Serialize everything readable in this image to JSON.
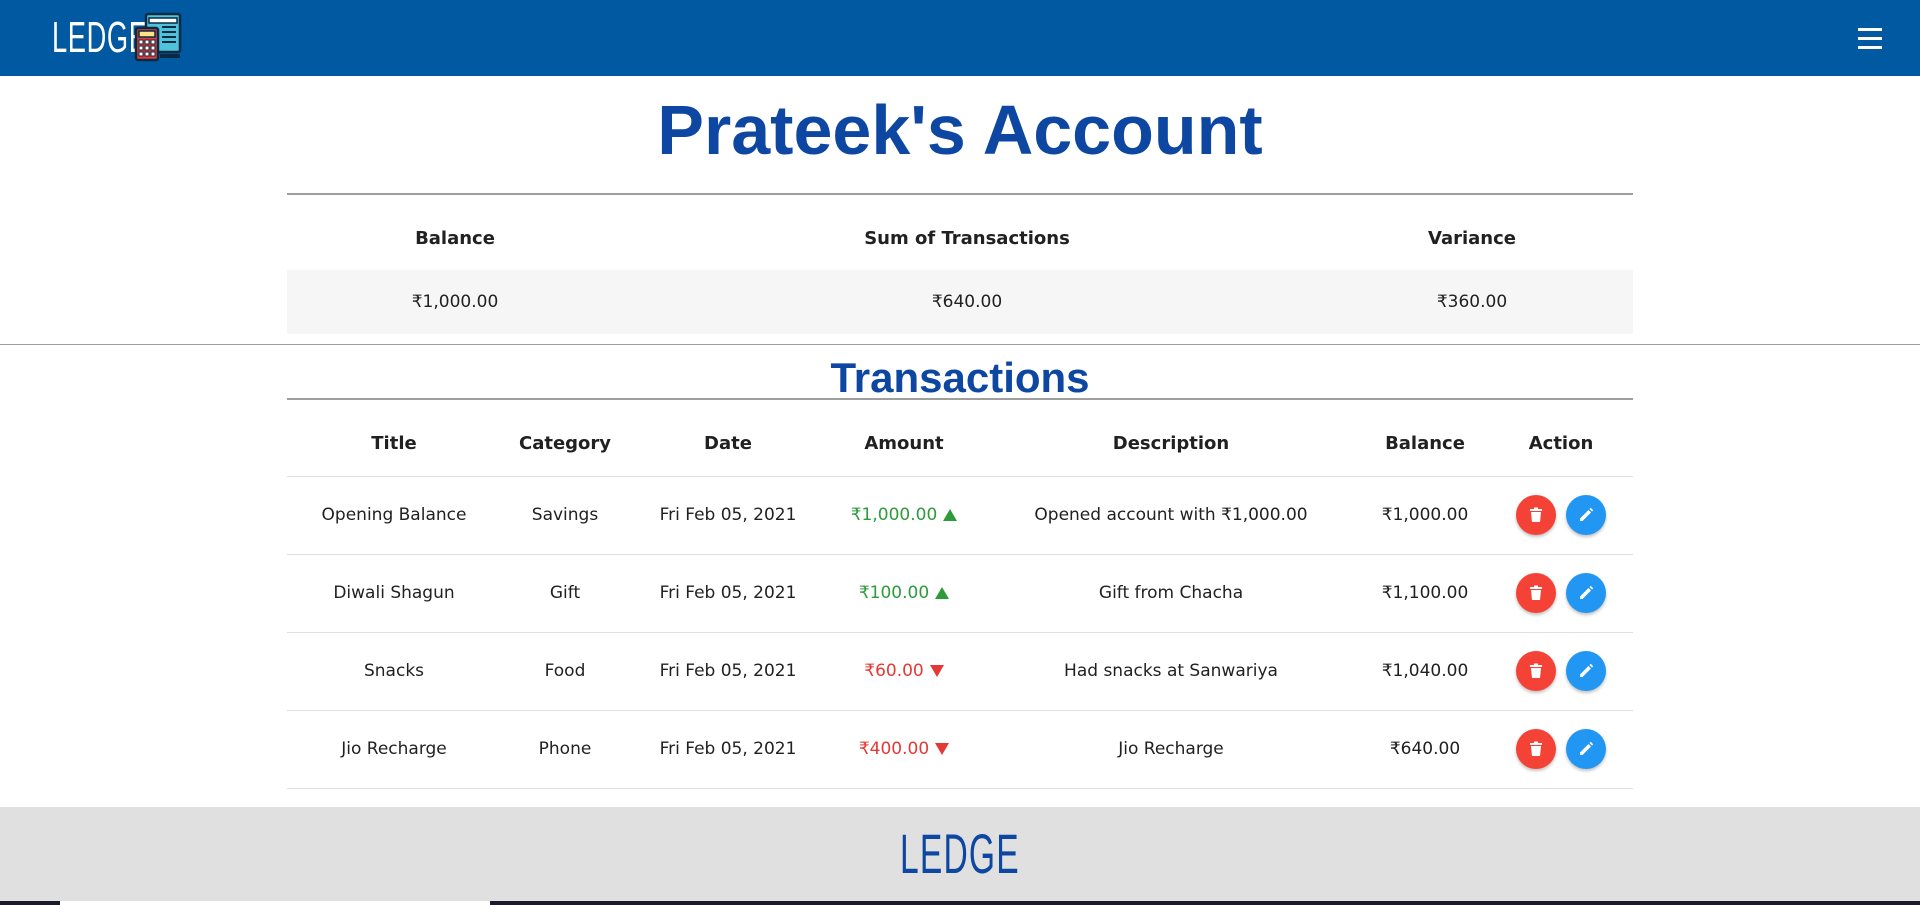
{
  "navbar": {
    "brand": "LEDGE",
    "logo_icon": "calculator-ledger-icon",
    "menu_icon": "hamburger-menu-icon",
    "background": "#0059a1"
  },
  "page": {
    "title": "Prateek's Account"
  },
  "summary": {
    "headers": [
      "Balance",
      "Sum of Transactions",
      "Variance"
    ],
    "values": [
      "₹1,000.00",
      "₹640.00",
      "₹360.00"
    ]
  },
  "transactions": {
    "title": "Transactions",
    "headers": [
      "Title",
      "Category",
      "Date",
      "Amount",
      "Description",
      "Balance",
      "Action"
    ],
    "rows": [
      {
        "title": "Opening Balance",
        "category": "Savings",
        "date": "Fri Feb 05, 2021",
        "amount": "₹1,000.00",
        "direction": "up",
        "description": "Opened account with ₹1,000.00",
        "balance": "₹1,000.00"
      },
      {
        "title": "Diwali Shagun",
        "category": "Gift",
        "date": "Fri Feb 05, 2021",
        "amount": "₹100.00",
        "direction": "up",
        "description": "Gift from Chacha",
        "balance": "₹1,100.00"
      },
      {
        "title": "Snacks",
        "category": "Food",
        "date": "Fri Feb 05, 2021",
        "amount": "₹60.00",
        "direction": "down",
        "description": "Had snacks at Sanwariya",
        "balance": "₹1,040.00"
      },
      {
        "title": "Jio Recharge",
        "category": "Phone",
        "date": "Fri Feb 05, 2021",
        "amount": "₹400.00",
        "direction": "down",
        "description": "Jio Recharge",
        "balance": "₹640.00"
      }
    ],
    "actions": {
      "delete_icon": "trash-icon",
      "edit_icon": "pencil-icon"
    }
  },
  "footer": {
    "brand": "LEDGE"
  },
  "colors": {
    "primary": "#0059a1",
    "heading": "#0d47a1",
    "positive": "#2e9b3b",
    "negative": "#e53935",
    "delete": "#f44336",
    "edit": "#2196f3",
    "footer": "#e0e0e0"
  }
}
